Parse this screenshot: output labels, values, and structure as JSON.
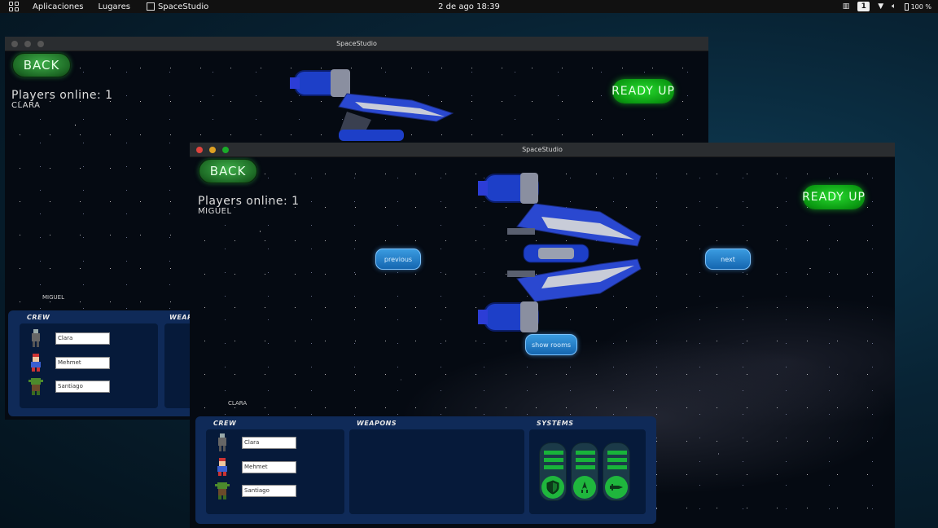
{
  "topbar": {
    "applications": "Aplicaciones",
    "places": "Lugares",
    "app_name": "SpaceStudio",
    "clock": "2 de ago 18:39",
    "workspace": "1",
    "battery": "100 %"
  },
  "back_window": {
    "title": "SpaceStudio",
    "back_label": "BACK",
    "ready_label": "READY UP",
    "players_online": "Players online: 1",
    "player_name": "CLARA",
    "tiny_label": "MIGUEL",
    "crew_header": "CREW",
    "weapons_header": "WEAPO",
    "crew": [
      "Clara",
      "Mehmet",
      "Santiago"
    ]
  },
  "front_window": {
    "title": "SpaceStudio",
    "back_label": "BACK",
    "ready_label": "READY UP",
    "players_online": "Players online: 1",
    "player_name": "MIGUEL",
    "previous_label": "previous",
    "next_label": "next",
    "show_rooms_label": "show rooms",
    "tiny_label": "CLARA",
    "crew_header": "CREW",
    "weapons_header": "WEAPONS",
    "systems_header": "SYSTEMS",
    "crew": [
      "Clara",
      "Mehmet",
      "Santiago"
    ],
    "systems": [
      {
        "icon": "shield-icon"
      },
      {
        "icon": "engine-icon"
      },
      {
        "icon": "weapon-icon"
      }
    ]
  },
  "colors": {
    "ready_green": "#0b9a12",
    "nav_blue": "#1566b0",
    "panel_blue": "#0f2a58",
    "system_green": "#1fb63d"
  }
}
